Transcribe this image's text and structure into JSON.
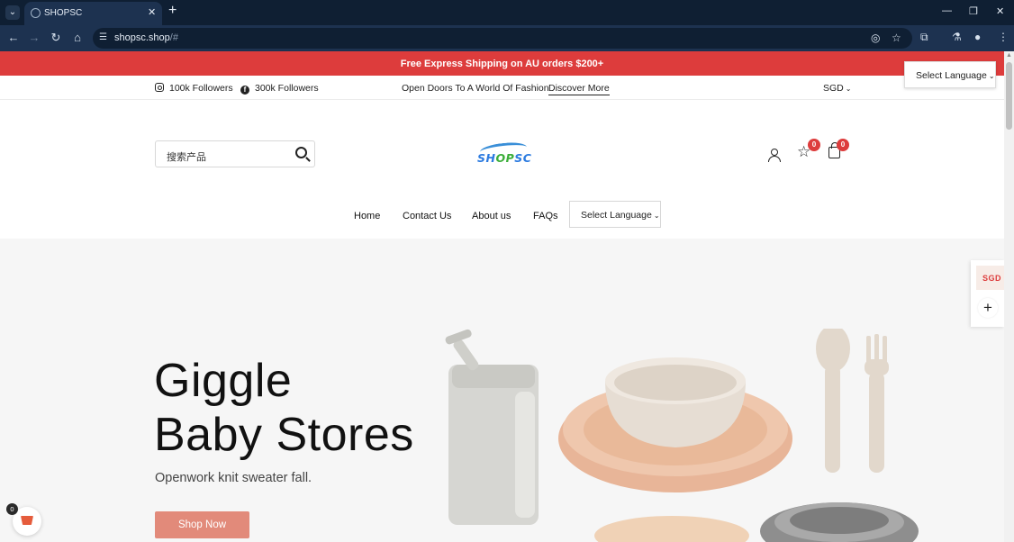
{
  "browser": {
    "tab_title": "SHOPSC",
    "tab_close": "✕",
    "new_tab": "+",
    "url_host": "shopsc.shop",
    "url_hash": "/#"
  },
  "promo": {
    "text": "Free Express Shipping on AU orders $200+"
  },
  "topbar": {
    "instagram_followers": "100k Followers",
    "facebook_followers": "300k Followers",
    "tagline": "Open Doors To A World Of Fashion",
    "discover_link": "Discover More",
    "currency": "SGD"
  },
  "language_dropdown": {
    "label": "Select Language"
  },
  "header": {
    "search_placeholder": "搜索产品",
    "logo_text_a": "SH",
    "logo_text_b": "OP",
    "logo_text_c": "SC",
    "wishlist_count": "0",
    "cart_count": "0"
  },
  "nav": {
    "items": [
      "Home",
      "Contact Us",
      "About us",
      "FAQs"
    ],
    "language_label": "Select Language"
  },
  "hero": {
    "title_line1": "Giggle",
    "title_line2": "Baby Stores",
    "subtitle": "Openwork knit sweater fall.",
    "cta": "Shop Now"
  },
  "side_widget": {
    "currency": "SGD",
    "add": "+"
  },
  "floating_cart": {
    "count": "0"
  },
  "colors": {
    "accent_red": "#dd3c3c",
    "cta_salmon": "#e28a7a",
    "chrome_dark": "#0f1f33"
  }
}
